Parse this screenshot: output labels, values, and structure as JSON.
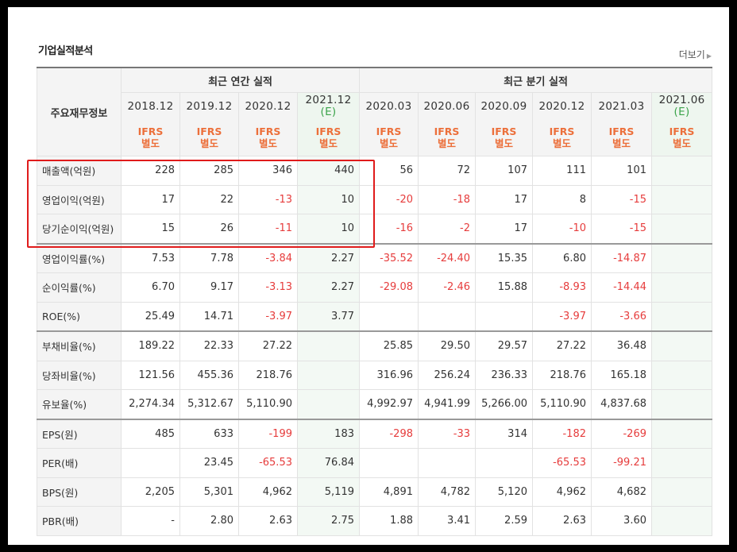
{
  "section_title": "기업실적분석",
  "more_link": "더보기",
  "header": {
    "metric_label": "주요재무정보",
    "annual_label": "최근 연간 실적",
    "quarter_label": "최근 분기 실적",
    "periods": [
      {
        "period": "2018.12",
        "type": "annual",
        "est": ""
      },
      {
        "period": "2019.12",
        "type": "annual",
        "est": ""
      },
      {
        "period": "2020.12",
        "type": "annual",
        "est": ""
      },
      {
        "period": "2021.12",
        "type": "annual",
        "est": "(E)"
      },
      {
        "period": "2020.03",
        "type": "quarter",
        "est": ""
      },
      {
        "period": "2020.06",
        "type": "quarter",
        "est": ""
      },
      {
        "period": "2020.09",
        "type": "quarter",
        "est": ""
      },
      {
        "period": "2020.12",
        "type": "quarter",
        "est": ""
      },
      {
        "period": "2021.03",
        "type": "quarter",
        "est": ""
      },
      {
        "period": "2021.06",
        "type": "quarter",
        "est": "(E)"
      }
    ],
    "ifrs_line1": "IFRS",
    "ifrs_line2": "별도"
  },
  "rows": [
    {
      "label": "매출액(억원)",
      "values": [
        "228",
        "285",
        "346",
        "440",
        "56",
        "72",
        "107",
        "111",
        "101",
        ""
      ]
    },
    {
      "label": "영업이익(억원)",
      "values": [
        "17",
        "22",
        "-13",
        "10",
        "-20",
        "-18",
        "17",
        "8",
        "-15",
        ""
      ]
    },
    {
      "label": "당기순이익(억원)",
      "values": [
        "15",
        "26",
        "-11",
        "10",
        "-16",
        "-2",
        "17",
        "-10",
        "-15",
        ""
      ]
    },
    {
      "label": "영업이익률(%)",
      "values": [
        "7.53",
        "7.78",
        "-3.84",
        "2.27",
        "-35.52",
        "-24.40",
        "15.35",
        "6.80",
        "-14.87",
        ""
      ]
    },
    {
      "label": "순이익률(%)",
      "values": [
        "6.70",
        "9.17",
        "-3.13",
        "2.27",
        "-29.08",
        "-2.46",
        "15.88",
        "-8.93",
        "-14.44",
        ""
      ]
    },
    {
      "label": "ROE(%)",
      "values": [
        "25.49",
        "14.71",
        "-3.97",
        "3.77",
        "",
        "",
        "",
        "-3.97",
        "-3.66",
        ""
      ]
    },
    {
      "label": "부채비율(%)",
      "values": [
        "189.22",
        "22.33",
        "27.22",
        "",
        "25.85",
        "29.50",
        "29.57",
        "27.22",
        "36.48",
        ""
      ]
    },
    {
      "label": "당좌비율(%)",
      "values": [
        "121.56",
        "455.36",
        "218.76",
        "",
        "316.96",
        "256.24",
        "236.33",
        "218.76",
        "165.18",
        ""
      ]
    },
    {
      "label": "유보율(%)",
      "values": [
        "2,274.34",
        "5,312.67",
        "5,110.90",
        "",
        "4,992.97",
        "4,941.99",
        "5,266.00",
        "5,110.90",
        "4,837.68",
        ""
      ]
    },
    {
      "label": "EPS(원)",
      "values": [
        "485",
        "633",
        "-199",
        "183",
        "-298",
        "-33",
        "314",
        "-182",
        "-269",
        ""
      ]
    },
    {
      "label": "PER(배)",
      "values": [
        "",
        "23.45",
        "-65.53",
        "76.84",
        "",
        "",
        "",
        "-65.53",
        "-99.21",
        ""
      ]
    },
    {
      "label": "BPS(원)",
      "values": [
        "2,205",
        "5,301",
        "4,962",
        "5,119",
        "4,891",
        "4,782",
        "5,120",
        "4,962",
        "4,682",
        ""
      ]
    },
    {
      "label": "PBR(배)",
      "values": [
        "-",
        "2.80",
        "2.63",
        "2.75",
        "1.88",
        "3.41",
        "2.59",
        "2.63",
        "3.60",
        ""
      ]
    }
  ],
  "colors": {
    "negative": "#e63c3c",
    "ifrs": "#ec6f3a",
    "estimate_mark": "#3ca44b",
    "highlight_box": "#e01b1b"
  }
}
